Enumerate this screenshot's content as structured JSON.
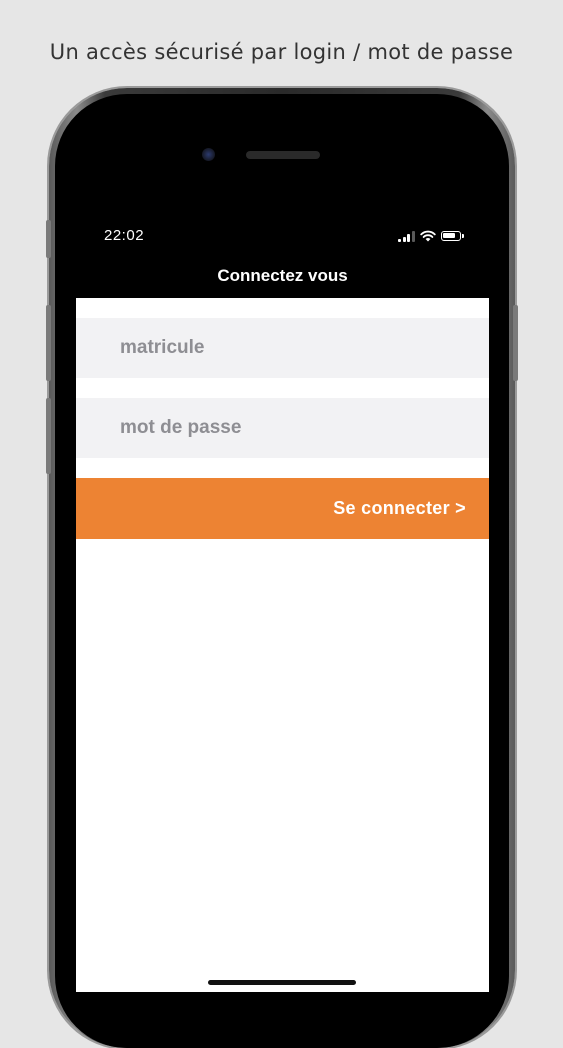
{
  "caption": "Un accès sécurisé par login / mot de passe",
  "status_bar": {
    "time": "22:02",
    "icons": [
      "cellular-signal-icon",
      "wifi-icon",
      "battery-icon"
    ]
  },
  "nav": {
    "title": "Connectez vous"
  },
  "login_form": {
    "matricule_placeholder": "matricule",
    "password_placeholder": "mot de passe",
    "submit_label": "Se connecter >"
  },
  "colors": {
    "accent": "#ed8333",
    "field_background": "#f2f2f4",
    "placeholder_text": "#8e8e93",
    "page_background": "#e6e6e6"
  }
}
